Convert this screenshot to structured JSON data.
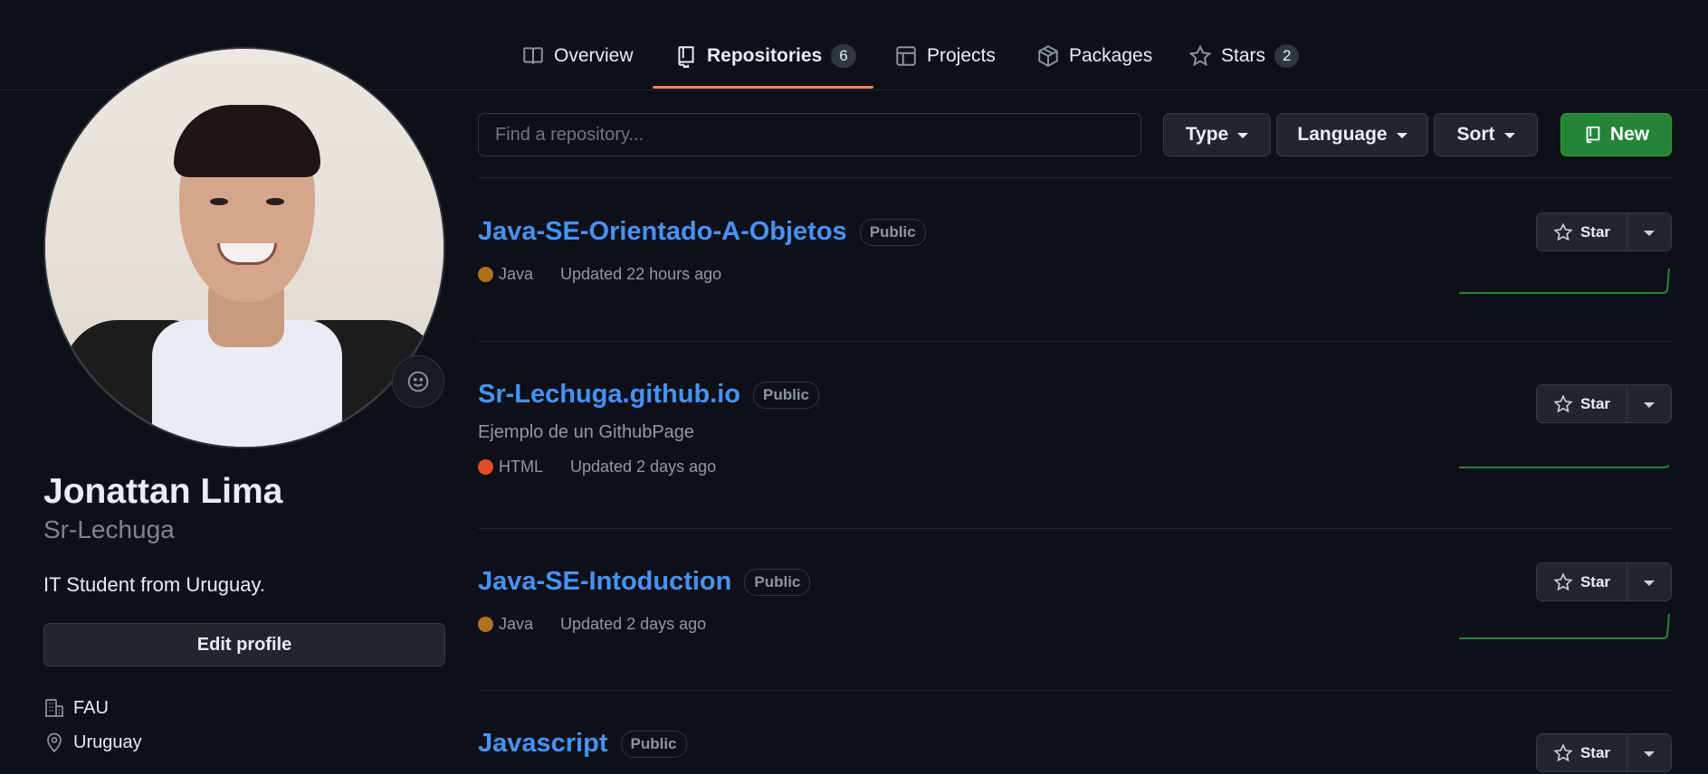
{
  "nav": {
    "tabs": [
      {
        "label": "Overview",
        "icon": "book-icon"
      },
      {
        "label": "Repositories",
        "icon": "repo-icon",
        "count": "6",
        "active": true
      },
      {
        "label": "Projects",
        "icon": "table-icon"
      },
      {
        "label": "Packages",
        "icon": "package-icon"
      },
      {
        "label": "Stars",
        "icon": "star-icon",
        "count": "2"
      }
    ]
  },
  "profile": {
    "full_name": "Jonattan Lima",
    "username": "Sr-Lechuga",
    "bio": "IT Student from Uruguay.",
    "edit_label": "Edit profile",
    "company": "FAU",
    "location": "Uruguay"
  },
  "toolbar": {
    "search_placeholder": "Find a repository...",
    "type_label": "Type",
    "language_label": "Language",
    "sort_label": "Sort",
    "new_label": "New"
  },
  "repos": [
    {
      "name": "Java-SE-Orientado-A-Objetos",
      "visibility": "Public",
      "description": "",
      "language": "Java",
      "language_color": "#b07219",
      "updated": "Updated 22 hours ago",
      "star_label": "Star"
    },
    {
      "name": "Sr-Lechuga.github.io",
      "visibility": "Public",
      "description": "Ejemplo de un GithubPage",
      "language": "HTML",
      "language_color": "#e34c26",
      "updated": "Updated 2 days ago",
      "star_label": "Star"
    },
    {
      "name": "Java-SE-Intoduction",
      "visibility": "Public",
      "description": "",
      "language": "Java",
      "language_color": "#b07219",
      "updated": "Updated 2 days ago",
      "star_label": "Star"
    },
    {
      "name": "Javascript",
      "visibility": "Public",
      "description": "",
      "language": "",
      "language_color": "",
      "updated": "",
      "star_label": "Star"
    }
  ],
  "colors": {
    "accent": "#4493f8",
    "tab_underline": "#f78166",
    "new_button": "#238636"
  }
}
